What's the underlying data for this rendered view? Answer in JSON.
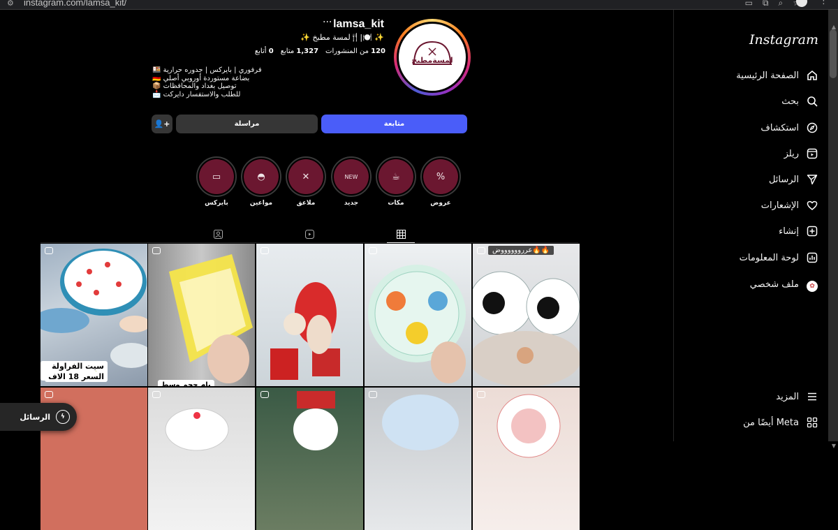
{
  "browser": {
    "url": "instagram.com/lamsa_kit/"
  },
  "sidebar": {
    "logo": "Instagram",
    "items": [
      {
        "label": "الصفحة الرئيسية",
        "icon": "home-icon"
      },
      {
        "label": "بحث",
        "icon": "search-icon"
      },
      {
        "label": "استكشاف",
        "icon": "compass-icon"
      },
      {
        "label": "ريلز",
        "icon": "reels-icon"
      },
      {
        "label": "الرسائل",
        "icon": "send-icon"
      },
      {
        "label": "الإشعارات",
        "icon": "heart-icon"
      },
      {
        "label": "إنشاء",
        "icon": "plus-square-icon"
      },
      {
        "label": "لوحة المعلومات",
        "icon": "dashboard-icon"
      },
      {
        "label": "ملف شخصي",
        "icon": "profile-avatar-icon"
      }
    ],
    "more_label": "المزيد",
    "meta_label": "أيضًا من Meta"
  },
  "profile": {
    "username": "lamsa_kit",
    "more_glyph": "···",
    "full_name": "✨ لمسة مطبخ🍴|🍽️ ✨",
    "stats": {
      "posts_count": "120",
      "posts_label": "من المنشورات",
      "followers_count": "1,327",
      "followers_label": "متابع",
      "following_count": "0",
      "following_label": "أتابع"
    },
    "bio": [
      "🍱 فرفوري | بايركس | جدوره حرارية",
      "🇩🇪 بضاعة مستوردة أوروبي أصلي",
      "📦 توصيل بغداد والمحافظات",
      "📩 للطلب والاستفسار دايركت"
    ],
    "logo_text": "لمسةمطبخ",
    "buttons": {
      "follow": "متابعة",
      "message": "مراسلة",
      "add_glyph": "⁺⁸"
    }
  },
  "highlights": [
    {
      "label": "عروض",
      "icon": "percent-icon"
    },
    {
      "label": "مكات",
      "icon": "mug-icon"
    },
    {
      "label": "جديد",
      "icon": "new-badge-icon"
    },
    {
      "label": "ملاعق",
      "icon": "utensils-icon"
    },
    {
      "label": "مواعين",
      "icon": "bowl-icon"
    },
    {
      "label": "بايركس",
      "icon": "baking-dish-icon"
    }
  ],
  "grid": {
    "captions": {
      "strawberry_title": "سيت الفراولة 🍓",
      "strawberry_price": "السعر 18 الاف",
      "glass_tray": "بام حجم وسط",
      "offers": "عررووووووض🔥🔥"
    }
  },
  "messages_pill": {
    "label": "الرسائل"
  },
  "colors": {
    "follow_button": "#4a5df9",
    "highlight_fill": "#6b1730"
  }
}
